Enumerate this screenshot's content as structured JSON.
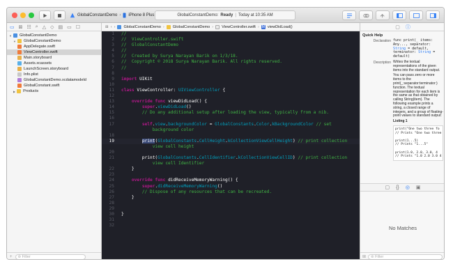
{
  "toolbar": {
    "scheme_target": "GlobalConstantDemo",
    "device": "iPhone 8 Plus",
    "status_project": "GlobalConstantDemo:",
    "status_state": "Ready",
    "status_sep": "|",
    "status_time": "Today at 10:35 AM"
  },
  "navigator": {
    "items": [
      {
        "label": "GlobalConstantDemo",
        "indent": 0,
        "kind": "project"
      },
      {
        "label": "GlobalConstantDemo",
        "indent": 1,
        "kind": "folder"
      },
      {
        "label": "AppDelegate.swift",
        "indent": 2,
        "kind": "swift"
      },
      {
        "label": "ViewController.swift",
        "indent": 2,
        "kind": "swift",
        "selected": true
      },
      {
        "label": "Main.storyboard",
        "indent": 2,
        "kind": "storyboard"
      },
      {
        "label": "Assets.xcassets",
        "indent": 2,
        "kind": "assets"
      },
      {
        "label": "LaunchScreen.storyboard",
        "indent": 2,
        "kind": "storyboard"
      },
      {
        "label": "Info.plist",
        "indent": 2,
        "kind": "plist"
      },
      {
        "label": "GlobalConstantDemo.xcdatamodeld",
        "indent": 2,
        "kind": "data"
      },
      {
        "label": "GlobalConstant.swift",
        "indent": 2,
        "kind": "swift"
      },
      {
        "label": "Products",
        "indent": 1,
        "kind": "folder"
      }
    ],
    "filter_placeholder": "Filter"
  },
  "jumpbar": {
    "crumbs": [
      "GlobalConstantDemo",
      "GlobalConstantDemo",
      "ViewController.swift",
      "viewDidLoad()"
    ],
    "method_badge": "M"
  },
  "editor": {
    "lines": [
      {
        "n": "1",
        "segs": [
          {
            "t": "//",
            "c": "com"
          }
        ]
      },
      {
        "n": "2",
        "segs": [
          {
            "t": "//  ViewController.swift",
            "c": "com"
          }
        ]
      },
      {
        "n": "3",
        "segs": [
          {
            "t": "//  GlobalConstantDemo",
            "c": "com"
          }
        ]
      },
      {
        "n": "4",
        "segs": [
          {
            "t": "//",
            "c": "com"
          }
        ]
      },
      {
        "n": "5",
        "segs": [
          {
            "t": "//  Created by Surya Narayan Barik on 1/3/18.",
            "c": "com"
          }
        ]
      },
      {
        "n": "6",
        "segs": [
          {
            "t": "//  Copyright © 2018 Surya Narayan Barik. All rights reserved.",
            "c": "com"
          }
        ]
      },
      {
        "n": "7",
        "segs": [
          {
            "t": "//",
            "c": "com"
          }
        ]
      },
      {
        "n": "8",
        "segs": []
      },
      {
        "n": "9",
        "segs": [
          {
            "t": "import",
            "c": "kw"
          },
          {
            "t": " UIKit",
            "c": "plain"
          }
        ]
      },
      {
        "n": "10",
        "segs": []
      },
      {
        "n": "11",
        "segs": [
          {
            "t": "class",
            "c": "kw"
          },
          {
            "t": " ViewController: ",
            "c": "plain"
          },
          {
            "t": "UIViewController",
            "c": "type"
          },
          {
            "t": " {",
            "c": "plain"
          }
        ]
      },
      {
        "n": "12",
        "segs": []
      },
      {
        "n": "13",
        "segs": [
          {
            "t": "    ",
            "c": "plain"
          },
          {
            "t": "override func",
            "c": "kw"
          },
          {
            "t": " viewDidLoad() {",
            "c": "plain"
          }
        ]
      },
      {
        "n": "14",
        "segs": [
          {
            "t": "        ",
            "c": "plain"
          },
          {
            "t": "super",
            "c": "kw"
          },
          {
            "t": ".",
            "c": "plain"
          },
          {
            "t": "viewDidLoad",
            "c": "type"
          },
          {
            "t": "()",
            "c": "plain"
          }
        ]
      },
      {
        "n": "15",
        "segs": [
          {
            "t": "        // Do any additional setup after loading the view, typically from a nib.",
            "c": "com"
          }
        ]
      },
      {
        "n": "16",
        "segs": []
      },
      {
        "n": "17",
        "segs": [
          {
            "t": "        ",
            "c": "plain"
          },
          {
            "t": "self",
            "c": "kw"
          },
          {
            "t": ".",
            "c": "plain"
          },
          {
            "t": "view",
            "c": "type"
          },
          {
            "t": ".",
            "c": "plain"
          },
          {
            "t": "backgroundColor",
            "c": "type"
          },
          {
            "t": " = ",
            "c": "plain"
          },
          {
            "t": "GlobalConstants",
            "c": "type"
          },
          {
            "t": ".",
            "c": "plain"
          },
          {
            "t": "Color",
            "c": "type"
          },
          {
            "t": ".",
            "c": "plain"
          },
          {
            "t": "kBackgroundColor",
            "c": "type"
          },
          {
            "t": " // set",
            "c": "com"
          }
        ]
      },
      {
        "n": "",
        "segs": [
          {
            "t": "            background color",
            "c": "com"
          }
        ]
      },
      {
        "n": "18",
        "segs": []
      },
      {
        "n": "19",
        "cur": true,
        "segs": [
          {
            "t": "        ",
            "c": "plain"
          },
          {
            "t": "print",
            "c": "sel"
          },
          {
            "t": "(",
            "c": "plain"
          },
          {
            "t": "GlobalConstants",
            "c": "type"
          },
          {
            "t": ".",
            "c": "plain"
          },
          {
            "t": "CellHeight",
            "c": "type"
          },
          {
            "t": ".",
            "c": "plain"
          },
          {
            "t": "kCollectionViewCellHeight",
            "c": "type"
          },
          {
            "t": ") ",
            "c": "plain"
          },
          {
            "t": "// print collection",
            "c": "com"
          }
        ]
      },
      {
        "n": "",
        "segs": [
          {
            "t": "            view cell height",
            "c": "com"
          }
        ]
      },
      {
        "n": "20",
        "segs": []
      },
      {
        "n": "21",
        "segs": [
          {
            "t": "        print(",
            "c": "plain"
          },
          {
            "t": "GlobalConstants",
            "c": "type"
          },
          {
            "t": ".",
            "c": "plain"
          },
          {
            "t": "CellIdentifier",
            "c": "type"
          },
          {
            "t": ".",
            "c": "plain"
          },
          {
            "t": "kCollectionViewCellID",
            "c": "type"
          },
          {
            "t": ") ",
            "c": "plain"
          },
          {
            "t": "// print collection",
            "c": "com"
          }
        ]
      },
      {
        "n": "",
        "segs": [
          {
            "t": "            view cell Identifier",
            "c": "com"
          }
        ]
      },
      {
        "n": "22",
        "segs": [
          {
            "t": "    }",
            "c": "plain"
          }
        ]
      },
      {
        "n": "23",
        "segs": []
      },
      {
        "n": "24",
        "segs": [
          {
            "t": "    ",
            "c": "plain"
          },
          {
            "t": "override func",
            "c": "kw"
          },
          {
            "t": " didReceiveMemoryWarning() {",
            "c": "plain"
          }
        ]
      },
      {
        "n": "25",
        "segs": [
          {
            "t": "        ",
            "c": "plain"
          },
          {
            "t": "super",
            "c": "kw"
          },
          {
            "t": ".",
            "c": "plain"
          },
          {
            "t": "didReceiveMemoryWarning",
            "c": "type"
          },
          {
            "t": "()",
            "c": "plain"
          }
        ]
      },
      {
        "n": "26",
        "segs": [
          {
            "t": "        // Dispose of any resources that can be recreated.",
            "c": "com"
          }
        ]
      },
      {
        "n": "27",
        "segs": [
          {
            "t": "    }",
            "c": "plain"
          }
        ]
      },
      {
        "n": "28",
        "segs": []
      },
      {
        "n": "29",
        "segs": []
      },
      {
        "n": "30",
        "segs": [
          {
            "t": "}",
            "c": "plain"
          }
        ]
      },
      {
        "n": "31",
        "segs": []
      },
      {
        "n": "32",
        "segs": []
      }
    ]
  },
  "inspector": {
    "title": "Quick Help",
    "declaration_label": "Declaration",
    "declaration_parts": [
      "func print(_ items: Any..., separator: ",
      "String",
      " = default, terminator: ",
      "String",
      " = default)"
    ],
    "description_label": "Description",
    "description": "Writes the textual representations of the given items into the standard output.",
    "description2": "You can pass zero or more items to the print(_:separator:terminator:) function. The textual representation for each item is the same as that obtained by calling String(item). The following example prints a string, a closed range of integers, and a group of floating-point values to standard output:",
    "listing_title": "Listing 1",
    "listing_lines": [
      "print(\"One two three fo",
      "// Prints \"One two three",
      "",
      "print(1...5)",
      "// Prints \"1...5\"",
      "",
      "print(1.0, 2.0, 3.0, 4",
      "// Prints \"1.0 2.0 3.0 4"
    ],
    "no_matches": "No Matches",
    "filter_placeholder": "Filter"
  },
  "colors": {
    "editor_bg": "#1f2028",
    "comment": "#41b645",
    "keyword": "#b21889",
    "type": "#00a0be",
    "accent": "#2c7cf6"
  }
}
